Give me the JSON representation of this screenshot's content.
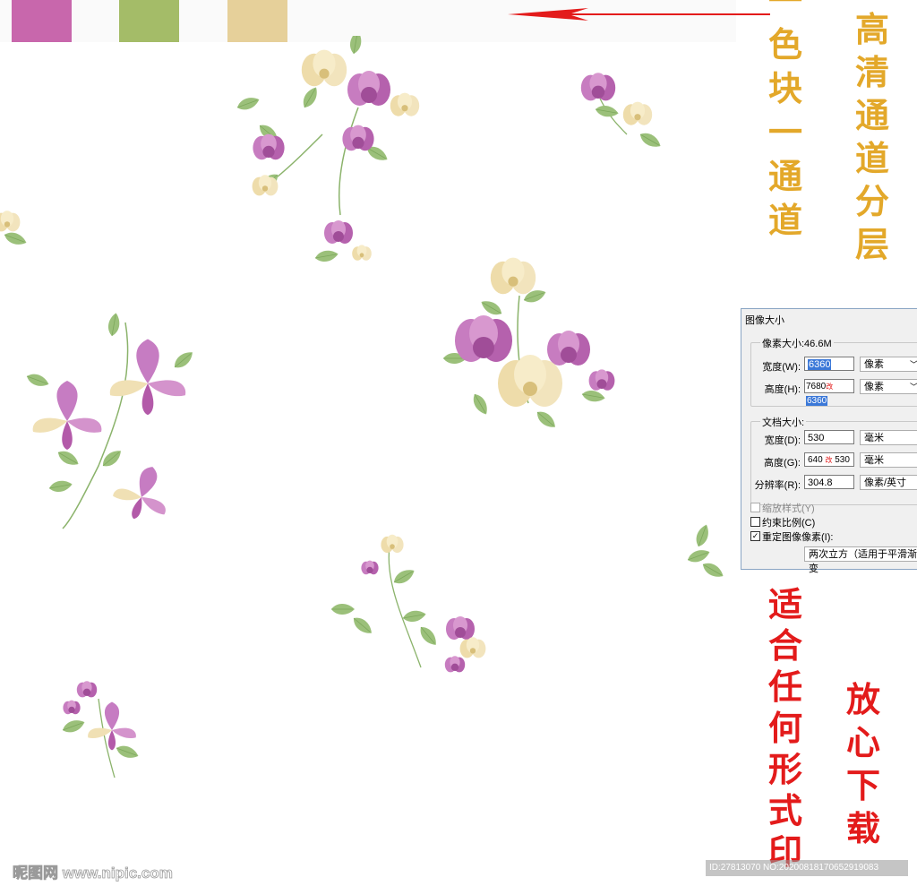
{
  "swatches": [
    {
      "name": "pink",
      "color": "#c867ac"
    },
    {
      "name": "green",
      "color": "#a4bc68"
    },
    {
      "name": "beige",
      "color": "#e6d09a"
    }
  ],
  "captions": {
    "hd_channels": "高清通道分层",
    "swatch_channel": "一色块一通道",
    "any_print": "适合任何形式印",
    "download": "放心下载"
  },
  "dialog": {
    "title": "图像大小",
    "pixel_size_label": "像素大小:46.6M",
    "width_label": "宽度(W):",
    "width_value": "6360",
    "width_unit": "像素",
    "height_label": "高度(H):",
    "height_old": "7680",
    "height_change_mark": "改",
    "height_value": "6360",
    "height_unit": "像素",
    "doc_size_label": "文档大小:",
    "doc_width_label": "宽度(D):",
    "doc_width_value": "530",
    "doc_width_unit": "毫米",
    "doc_height_label": "高度(G):",
    "doc_height_old": "640",
    "doc_height_change_mark": "改",
    "doc_height_value": "530",
    "doc_height_unit": "毫米",
    "resolution_label": "分辨率(R):",
    "resolution_value": "304.8",
    "resolution_unit": "像素/英寸",
    "scale_styles_label": "缩放样式(Y)",
    "constrain_label": "约束比例(C)",
    "resample_label": "重定图像像素(I):",
    "resample_method": "两次立方（适用于平滑渐变"
  },
  "watermark": {
    "logo_text": "昵图网 www.nipic.com",
    "id_text": "ID:27813070 NO:20200818170652919083"
  },
  "icons": {
    "arrow": "left-arrow-icon",
    "flower": "flower-icon",
    "dropdown": "chevron-down-icon"
  }
}
